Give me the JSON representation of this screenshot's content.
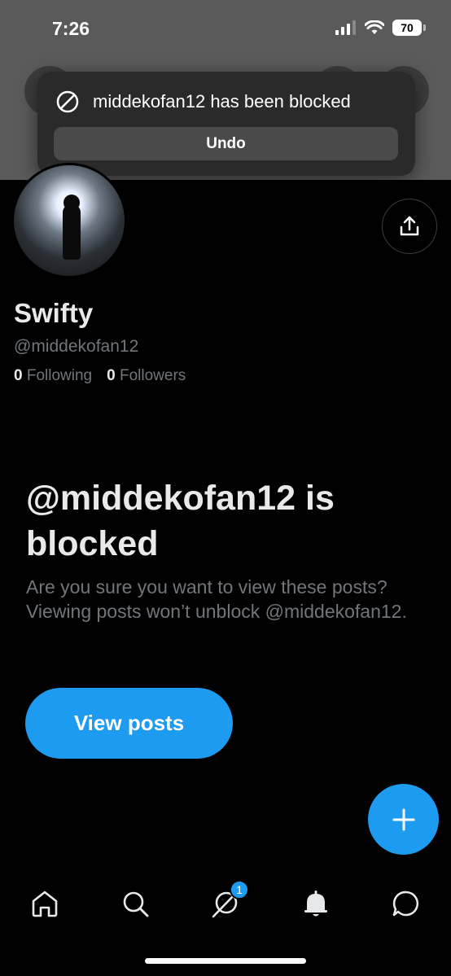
{
  "status_bar": {
    "time": "7:26",
    "battery": "70"
  },
  "toast": {
    "message": "middekofan12 has been blocked",
    "undo_label": "Undo"
  },
  "profile": {
    "name": "Swifty",
    "handle": "@middekofan12",
    "following_count": "0",
    "following_label": "Following",
    "followers_count": "0",
    "followers_label": "Followers"
  },
  "blocked": {
    "title": "@middekofan12 is blocked",
    "description": "Are you sure you want to view these posts? Viewing posts won’t unblock @middekofan12.",
    "view_posts_label": "View posts"
  },
  "tabbar": {
    "items": [
      {
        "icon": "home-icon"
      },
      {
        "icon": "search-icon"
      },
      {
        "icon": "grok-icon",
        "badge": "1"
      },
      {
        "icon": "bell-icon"
      },
      {
        "icon": "messages-icon"
      }
    ]
  },
  "colors": {
    "accent": "#1d9bf0",
    "background": "#000000",
    "muted": "#71767b"
  }
}
